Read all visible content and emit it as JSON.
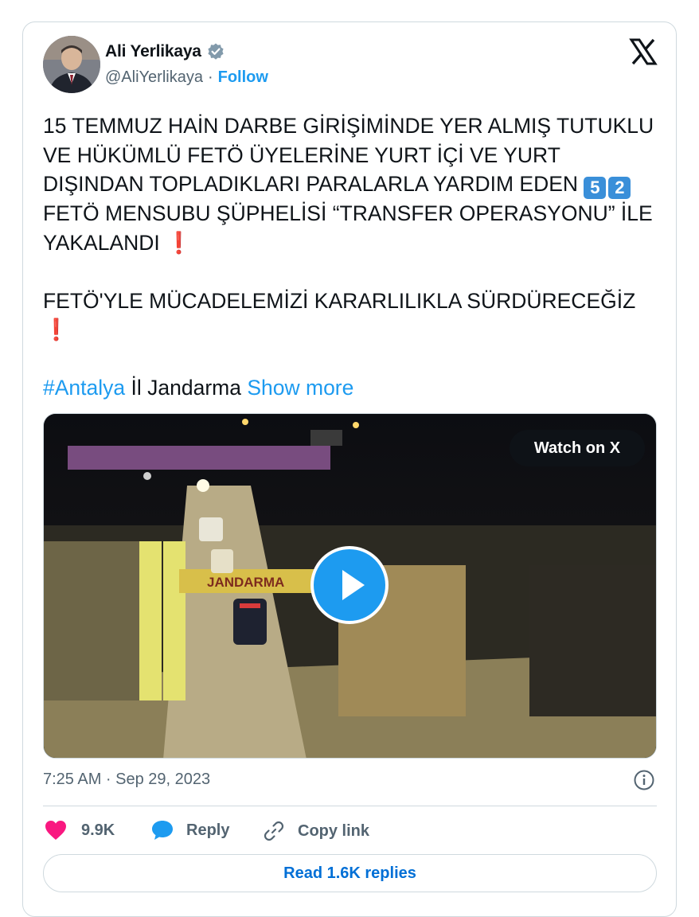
{
  "author": {
    "name": "Ali Yerlikaya",
    "handle": "@AliYerlikaya",
    "separator": "·",
    "follow_label": "Follow",
    "verified": true
  },
  "tweet": {
    "line1a": "15 TEMMUZ HAİN DARBE GİRİŞİMİNDE YER ALMIŞ TUTUKLU VE HÜKÜMLÜ FETÖ ÜYELERİNE YURT İÇİ VE YURT DIŞINDAN TOPLADIKLARI PARALARLA YARDIM EDEN",
    "digit1": "5",
    "digit2": "2",
    "line1b": "FETÖ MENSUBU ŞÜPHELİSİ “TRANSFER OPERASYONU” İLE YAKALANDI",
    "exclamation": "❗",
    "line2": "FETÖ'YLE MÜCADELEMİZİ KARARLILIKLA SÜRDÜRECEĞİZ",
    "hashtag": "#Antalya",
    "mention_text": "İl Jandarma",
    "show_more": "Show more"
  },
  "media": {
    "watch_label": "Watch on X",
    "sign_text": "JANDARMA"
  },
  "meta": {
    "timestamp": "7:25 AM · Sep 29, 2023"
  },
  "actions": {
    "likes": "9.9K",
    "reply": "Reply",
    "copy_link": "Copy link",
    "read_replies": "Read 1.6K replies"
  },
  "colors": {
    "accent": "#1d9bf0",
    "like": "#f91880",
    "text": "#0f1419",
    "muted": "#536471",
    "border": "#cfd9de"
  }
}
